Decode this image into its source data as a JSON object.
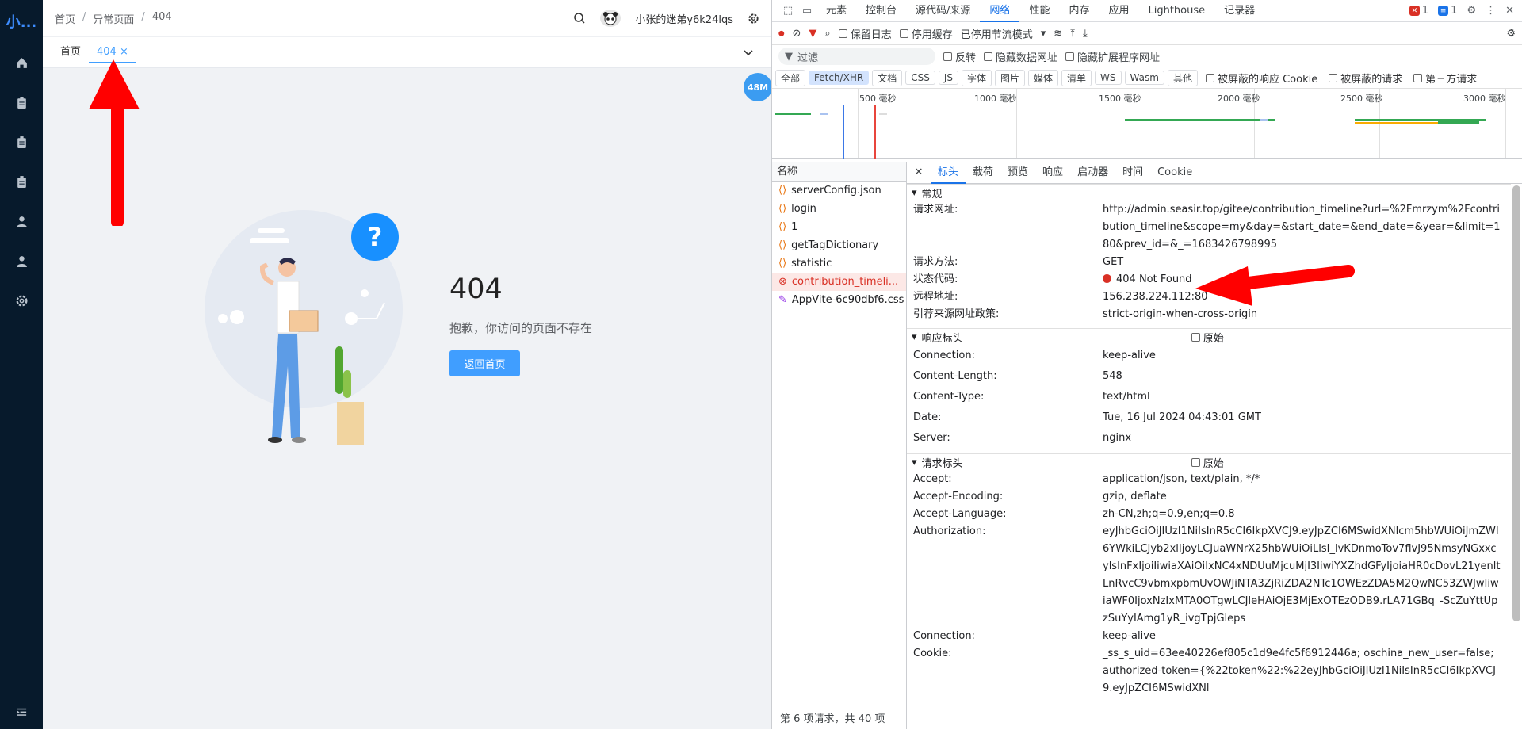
{
  "app": {
    "logo": "小...",
    "breadcrumb": [
      "首页",
      "异常页面",
      "404"
    ],
    "username": "小张的迷弟y6k24lqs",
    "tabs": [
      {
        "label": "首页"
      },
      {
        "label": "404 ×"
      }
    ],
    "memory": "48M",
    "error": {
      "code": "404",
      "message": "抱歉，你访问的页面不存在",
      "button": "返回首页"
    }
  },
  "devtools": {
    "tabs": [
      "元素",
      "控制台",
      "源代码/来源",
      "网络",
      "性能",
      "内存",
      "应用",
      "Lighthouse",
      "记录器"
    ],
    "active_tab": "网络",
    "errors": "1",
    "messages": "1",
    "toolbar": {
      "preserve_log": "保留日志",
      "disable_cache": "停用缓存",
      "throttle": "已停用节流模式"
    },
    "filter": {
      "placeholder": "过滤",
      "invert": "反转",
      "hide_data": "隐藏数据网址",
      "hide_ext": "隐藏扩展程序网址"
    },
    "types": [
      "全部",
      "Fetch/XHR",
      "文档",
      "CSS",
      "JS",
      "字体",
      "图片",
      "媒体",
      "清单",
      "WS",
      "Wasm",
      "其他"
    ],
    "blocked_cookie": "被屏蔽的响应 Cookie",
    "blocked_req": "被屏蔽的请求",
    "third_party": "第三方请求",
    "timeline_ticks": [
      "500 毫秒",
      "1000 毫秒",
      "1500 毫秒",
      "2000 毫秒",
      "2500 毫秒",
      "3000 毫秒"
    ],
    "names_header": "名称",
    "requests": [
      {
        "name": "serverConfig.json",
        "kind": "xhr"
      },
      {
        "name": "login",
        "kind": "xhr"
      },
      {
        "name": "1",
        "kind": "xhr"
      },
      {
        "name": "getTagDictionary",
        "kind": "xhr"
      },
      {
        "name": "statistic",
        "kind": "xhr"
      },
      {
        "name": "contribution_timeli...",
        "kind": "error"
      },
      {
        "name": "AppVite-6c90dbf6.css",
        "kind": "css"
      }
    ],
    "footer": "第 6 项请求，共 40 项",
    "detail_tabs": [
      "标头",
      "载荷",
      "预览",
      "响应",
      "启动器",
      "时间",
      "Cookie"
    ],
    "general": {
      "title": "常规",
      "rows": [
        {
          "k": "请求网址:",
          "v": "http://admin.seasir.top/gitee/contribution_timeline?url=%2Fmrzym%2Fcontribution_timeline&scope=my&day=&start_date=&end_date=&year=&limit=180&prev_id=&_=1683426798995"
        },
        {
          "k": "请求方法:",
          "v": "GET"
        },
        {
          "k": "状态代码:",
          "v": "404 Not Found"
        },
        {
          "k": "远程地址:",
          "v": "156.238.224.112:80"
        },
        {
          "k": "引荐来源网址政策:",
          "v": "strict-origin-when-cross-origin"
        }
      ]
    },
    "response_headers": {
      "title": "响应标头",
      "raw": "原始",
      "rows": [
        {
          "k": "Connection:",
          "v": "keep-alive"
        },
        {
          "k": "Content-Length:",
          "v": "548"
        },
        {
          "k": "Content-Type:",
          "v": "text/html"
        },
        {
          "k": "Date:",
          "v": "Tue, 16 Jul 2024 04:43:01 GMT"
        },
        {
          "k": "Server:",
          "v": "nginx"
        }
      ]
    },
    "request_headers": {
      "title": "请求标头",
      "raw": "原始",
      "rows": [
        {
          "k": "Accept:",
          "v": "application/json, text/plain, */*"
        },
        {
          "k": "Accept-Encoding:",
          "v": "gzip, deflate"
        },
        {
          "k": "Accept-Language:",
          "v": "zh-CN,zh;q=0.9,en;q=0.8"
        },
        {
          "k": "Authorization:",
          "v": "eyJhbGciOiJIUzI1NiIsInR5cCI6IkpXVCJ9.eyJpZCI6MSwidXNlcm5hbWUiOiJmZWI6YWkiLCJyb2xlIjoyLCJuaWNrX25hbWUiOiLlsI_lvKDnmoTov7flvJ95NmsyNGxxcylsInFxIjoiIiwiaXAiOiIxNC4xNDUuMjcuMjI3IiwiYXZhdGFyIjoiaHR0cDovL21yenltLnRvcC9vbmxpbmUvOWJiNTA3ZjRiZDA2NTc1OWEzZDA5M2QwNC53ZWJwIiwiaWF0IjoxNzIxMTA0OTgwLCJleHAiOjE3MjExOTEzODB9.rLA71GBq_-ScZuYttUpzSuYyIAmg1yR_ivgTpjGleps"
        },
        {
          "k": "Connection:",
          "v": "keep-alive"
        },
        {
          "k": "Cookie:",
          "v": "_ss_s_uid=63ee40226ef805c1d9e4fc5f6912446a; oschina_new_user=false; authorized-token={%22token%22:%22eyJhbGciOiJIUzI1NiIsInR5cCI6IkpXVCJ9.eyJpZCI6MSwidXNl"
        }
      ]
    }
  }
}
